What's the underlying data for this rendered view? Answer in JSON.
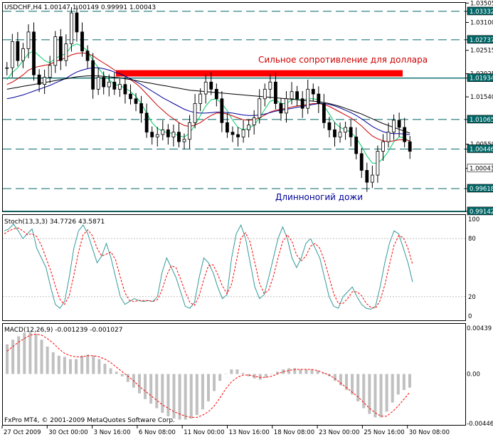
{
  "main": {
    "title": "USDCHF,H4  1.00147 1.00149 0.99991 1.00043",
    "annotation_resistance": "Сильное сопротивление для доллара",
    "annotation_doji": "Длинноногий дожи",
    "colors": {
      "candle": "#000000",
      "ma_fast": "#00cc66",
      "ma_mid": "#cc0000",
      "ma_slow": "#000099",
      "ma_long": "#000000",
      "levels": "#006666",
      "resistance_zone": "#ff0000",
      "ann_resistance": "#cc0000",
      "ann_doji": "#000099"
    }
  },
  "stoch": {
    "title": "Stoch(13,3,3) 34.7726 43.5871",
    "colors": {
      "main": "#339999",
      "signal": "#ff0000"
    }
  },
  "macd": {
    "title": "MACD(12,26,9) -0.001239 -0.001027",
    "colors": {
      "hist": "#c0c0c0",
      "signal": "#ff0000"
    }
  },
  "footer": "FxPro MT4, © 2001-2009 MetaQuotes Software Corp.",
  "chart_data": [
    {
      "type": "candlestick",
      "title": "USDCHF,H4",
      "ohlc_last": {
        "open": 1.00147,
        "high": 1.00149,
        "low": 0.99991,
        "close": 1.00043
      },
      "y_ticks": [
        "1.03505",
        "1.03332",
        "1.03100",
        "1.02737",
        "1.02515",
        "1.02025",
        "1.01934",
        "1.01540",
        "1.01065",
        "1.00550",
        "1.00446",
        "1.00043",
        "0.99618",
        "0.99142"
      ],
      "ylim": [
        0.9914,
        1.0351
      ],
      "levels": [
        1.03332,
        1.02737,
        1.01934,
        1.01065,
        1.00446,
        0.99618,
        0.99142
      ],
      "resistance_zone": [
        1.0203,
        1.021
      ],
      "annotations": [
        "Сильное сопротивление для доллара",
        "Длинноногий дожи"
      ],
      "closes": [
        1.0215,
        1.027,
        1.023,
        1.0255,
        1.029,
        1.02,
        1.018,
        1.0195,
        1.022,
        1.028,
        1.023,
        1.0265,
        1.033,
        1.029,
        1.025,
        1.023,
        1.017,
        1.0195,
        1.0175,
        1.0185,
        1.017,
        1.018,
        1.016,
        1.015,
        1.014,
        1.012,
        1.008,
        1.007,
        1.0075,
        1.0085,
        1.007,
        1.008,
        1.006,
        1.0065,
        1.01,
        1.014,
        1.016,
        1.0185,
        1.017,
        1.015,
        1.01,
        1.008,
        1.0075,
        1.007,
        1.0085,
        1.0095,
        1.011,
        1.015,
        1.017,
        1.0185,
        1.014,
        1.012,
        1.015,
        1.0165,
        1.015,
        1.013,
        1.017,
        1.016,
        1.014,
        1.01,
        1.0085,
        1.007,
        1.008,
        1.009,
        1.007,
        1.0035,
        1.0,
        0.9975,
        0.999,
        1.004,
        1.006,
        1.008,
        1.0105,
        1.009,
        1.006,
        1.004
      ],
      "series": [
        {
          "name": "MA fast",
          "color": "#00cc66",
          "values": [
            1.019,
            1.0205,
            1.0215,
            1.023,
            1.0245,
            1.025,
            1.024,
            1.023,
            1.0225,
            1.0235,
            1.024,
            1.0245,
            1.026,
            1.0265,
            1.026,
            1.025,
            1.023,
            1.0215,
            1.02,
            1.019,
            1.018,
            1.0178,
            1.0172,
            1.0165,
            1.0155,
            1.014,
            1.012,
            1.01,
            1.0088,
            1.0082,
            1.0078,
            1.0078,
            1.0072,
            1.007,
            1.0078,
            1.0095,
            1.0115,
            1.0135,
            1.0148,
            1.015,
            1.014,
            1.0125,
            1.0105,
            1.009,
            1.0085,
            1.0088,
            1.0095,
            1.011,
            1.0128,
            1.0145,
            1.0148,
            1.014,
            1.014,
            1.0148,
            1.015,
            1.0145,
            1.015,
            1.015,
            1.0148,
            1.0135,
            1.0118,
            1.01,
            1.009,
            1.0085,
            1.008,
            1.0068,
            1.005,
            1.003,
            1.0015,
            1.0015,
            1.0025,
            1.004,
            1.006,
            1.007,
            1.0068,
            1.006
          ]
        },
        {
          "name": "MA mid",
          "color": "#cc0000",
          "values": [
            1.018,
            1.0185,
            1.0192,
            1.02,
            1.021,
            1.0215,
            1.0218,
            1.022,
            1.0222,
            1.0228,
            1.0232,
            1.0236,
            1.0242,
            1.0245,
            1.0246,
            1.0245,
            1.024,
            1.0232,
            1.0225,
            1.0218,
            1.021,
            1.0205,
            1.0198,
            1.019,
            1.0182,
            1.0172,
            1.016,
            1.0148,
            1.0136,
            1.0126,
            1.0116,
            1.0108,
            1.01,
            1.0094,
            1.0092,
            1.0095,
            1.01,
            1.0108,
            1.0115,
            1.012,
            1.012,
            1.0118,
            1.0114,
            1.011,
            1.0106,
            1.0105,
            1.0106,
            1.011,
            1.0116,
            1.0122,
            1.0126,
            1.0128,
            1.013,
            1.0133,
            1.0135,
            1.0136,
            1.0138,
            1.014,
            1.014,
            1.0138,
            1.0134,
            1.0128,
            1.0122,
            1.0116,
            1.011,
            1.0102,
            1.0093,
            1.0082,
            1.0072,
            1.0066,
            1.0062,
            1.006,
            1.0062,
            1.0064,
            1.0064,
            1.0062
          ]
        },
        {
          "name": "MA slow",
          "color": "#000099",
          "values": [
            1.015,
            1.0152,
            1.0155,
            1.0158,
            1.0162,
            1.0166,
            1.017,
            1.0174,
            1.0178,
            1.0183,
            1.0188,
            1.0193,
            1.02,
            1.0206,
            1.021,
            1.0213,
            1.0215,
            1.0215,
            1.0213,
            1.021,
            1.0206,
            1.0202,
            1.0197,
            1.0192,
            1.0186,
            1.018,
            1.0173,
            1.0166,
            1.0159,
            1.0152,
            1.0146,
            1.014,
            1.0134,
            1.0128,
            1.0124,
            1.0121,
            1.012,
            1.012,
            1.0121,
            1.0122,
            1.0122,
            1.0121,
            1.012,
            1.0118,
            1.0116,
            1.0115,
            1.0115,
            1.0116,
            1.0118,
            1.0121,
            1.0124,
            1.0126,
            1.0128,
            1.013,
            1.0132,
            1.0134,
            1.0136,
            1.0138,
            1.014,
            1.014,
            1.0138,
            1.0135,
            1.0131,
            1.0126,
            1.0121,
            1.0115,
            1.0108,
            1.01,
            1.0092,
            1.0086,
            1.0081,
            1.0078,
            1.0077,
            1.0077,
            1.0076,
            1.0075
          ]
        },
        {
          "name": "MA long",
          "color": "#000000",
          "values": [
            1.017,
            1.0172,
            1.0174,
            1.0176,
            1.0178,
            1.018,
            1.0182,
            1.0184,
            1.0186,
            1.0188,
            1.019,
            1.0192,
            1.0194,
            1.0196,
            1.0197,
            1.0198,
            1.0198,
            1.0198,
            1.0197,
            1.0196,
            1.0195,
            1.0194,
            1.0192,
            1.019,
            1.0188,
            1.0186,
            1.0184,
            1.0182,
            1.018,
            1.0178,
            1.0176,
            1.0174,
            1.0172,
            1.017,
            1.0168,
            1.0167,
            1.0166,
            1.0165,
            1.0164,
            1.0163,
            1.0162,
            1.0161,
            1.016,
            1.0159,
            1.0158,
            1.0157,
            1.0156,
            1.0155,
            1.0154,
            1.0153,
            1.0152,
            1.0151,
            1.015,
            1.0149,
            1.0148,
            1.0147,
            1.0146,
            1.0145,
            1.0144,
            1.0142,
            1.014,
            1.0137,
            1.0134,
            1.013,
            1.0126,
            1.0122,
            1.0118,
            1.0113,
            1.0108,
            1.0103,
            1.0098,
            1.0094,
            1.009,
            1.0086,
            1.0082,
            1.0078
          ]
        }
      ],
      "x_ticks": [
        "27 Oct 2009",
        "30 Oct 00:00",
        "3 Nov 16:00",
        "6 Nov 08:00",
        "11 Nov 00:00",
        "13 Nov 16:00",
        "18 Nov 08:00",
        "23 Nov 00:00",
        "25 Nov 16:00",
        "30 Nov 08:00"
      ]
    },
    {
      "type": "line",
      "title": "Stoch(13,3,3) 34.7726 43.5871",
      "ylim": [
        0,
        100
      ],
      "y_ticks": [
        "100",
        "80",
        "20",
        "0"
      ],
      "series": [
        {
          "name": "Main",
          "color": "#339999",
          "values": [
            88,
            90,
            95,
            88,
            80,
            85,
            90,
            70,
            60,
            50,
            30,
            12,
            8,
            15,
            40,
            70,
            88,
            94,
            85,
            70,
            55,
            62,
            75,
            60,
            40,
            20,
            12,
            15,
            18,
            16,
            15,
            16,
            15,
            20,
            45,
            60,
            50,
            40,
            25,
            10,
            8,
            14,
            40,
            60,
            55,
            45,
            30,
            18,
            22,
            60,
            85,
            94,
            80,
            55,
            30,
            18,
            22,
            40,
            60,
            80,
            92,
            80,
            60,
            50,
            60,
            75,
            80,
            70,
            60,
            40,
            20,
            10,
            8,
            20,
            25,
            30,
            20,
            12,
            8,
            7,
            10,
            30,
            55,
            75,
            88,
            85,
            70,
            55,
            35
          ]
        },
        {
          "name": "Signal",
          "color": "#ff0000",
          "values": [
            85,
            88,
            90,
            91,
            88,
            84,
            85,
            82,
            73,
            60,
            47,
            31,
            17,
            12,
            21,
            42,
            66,
            84,
            89,
            83,
            70,
            62,
            64,
            66,
            58,
            40,
            24,
            16,
            15,
            16,
            16,
            16,
            15,
            17,
            27,
            42,
            52,
            50,
            38,
            25,
            14,
            11,
            21,
            38,
            52,
            53,
            43,
            31,
            23,
            33,
            56,
            80,
            86,
            76,
            55,
            34,
            23,
            27,
            41,
            60,
            77,
            84,
            77,
            63,
            57,
            62,
            72,
            75,
            70,
            57,
            40,
            23,
            13,
            13,
            18,
            25,
            25,
            21,
            13,
            9,
            8,
            16,
            32,
            53,
            73,
            83,
            81,
            70,
            53
          ]
        }
      ]
    },
    {
      "type": "bar+line",
      "title": "MACD(12,26,9) -0.001239 -0.001027",
      "ylim": [
        -0.00446,
        0.00439
      ],
      "y_ticks": [
        "0.00439",
        "0.00",
        "-0.00446"
      ],
      "series": [
        {
          "name": "MACD",
          "color": "#c0c0c0",
          "values": [
            0.0026,
            0.003,
            0.0033,
            0.0036,
            0.0037,
            0.0035,
            0.003,
            0.0024,
            0.0019,
            0.0016,
            0.0015,
            0.0013,
            0.0013,
            0.0016,
            0.0017,
            0.0016,
            0.0013,
            0.0009,
            0.0005,
            0.0002,
            -0.0002,
            -0.0007,
            -0.0012,
            -0.0017,
            -0.0022,
            -0.0026,
            -0.003,
            -0.0034,
            -0.0037,
            -0.0039,
            -0.004,
            -0.004,
            -0.0039,
            -0.0036,
            -0.0031,
            -0.0024,
            -0.0015,
            -0.0006,
            0.0,
            0.0004,
            0.0004,
            0.0001,
            -0.0002,
            -0.0004,
            -0.0005,
            -0.0003,
            0.0,
            0.0002,
            0.0004,
            0.0005,
            0.0005,
            0.0004,
            0.0004,
            0.0004,
            0.0003,
            0.0001,
            -0.0002,
            -0.0006,
            -0.001,
            -0.0014,
            -0.0018,
            -0.0024,
            -0.003,
            -0.0035,
            -0.0038,
            -0.0038,
            -0.0033,
            -0.0025,
            -0.0018,
            -0.0014,
            -0.0012
          ]
        },
        {
          "name": "Signal",
          "color": "#ff0000",
          "values": [
            0.002,
            0.0024,
            0.0028,
            0.0031,
            0.0034,
            0.0035,
            0.0034,
            0.0031,
            0.0027,
            0.0022,
            0.0018,
            0.0016,
            0.0015,
            0.0015,
            0.0016,
            0.0016,
            0.0015,
            0.0013,
            0.001,
            0.0006,
            0.0002,
            -0.0002,
            -0.0006,
            -0.0011,
            -0.0015,
            -0.0019,
            -0.0023,
            -0.0027,
            -0.003,
            -0.0033,
            -0.0035,
            -0.0037,
            -0.0038,
            -0.0038,
            -0.0036,
            -0.0033,
            -0.0028,
            -0.0021,
            -0.0013,
            -0.0007,
            -0.0003,
            -0.0001,
            -0.0001,
            -0.0002,
            -0.0003,
            -0.0003,
            -0.0002,
            0.0,
            0.0002,
            0.0003,
            0.0004,
            0.0004,
            0.0004,
            0.0004,
            0.0003,
            0.0001,
            -0.0001,
            -0.0004,
            -0.0008,
            -0.0012,
            -0.0016,
            -0.002,
            -0.0025,
            -0.003,
            -0.0034,
            -0.0037,
            -0.0037,
            -0.0033,
            -0.0028,
            -0.0022,
            -0.0016
          ]
        }
      ]
    }
  ]
}
